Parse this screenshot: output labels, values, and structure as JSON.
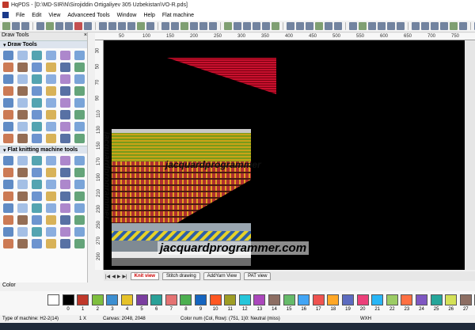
{
  "window": {
    "title": "HqPDS - [D:\\MD-SIR\\N\\Sirojiddin Ortigaliyev 305 Uzbekistan\\VO-R.pds]"
  },
  "menu": [
    "File",
    "Edit",
    "View",
    "Advanceed Tools",
    "Window",
    "Help",
    "Flat machine"
  ],
  "panel": {
    "title": "Draw Tools",
    "close_glyph": "×",
    "group_draw": "Draw Tools",
    "group_flat": "Flat knitting machine tools"
  },
  "ruler": {
    "top": [
      "50",
      "100",
      "150",
      "200",
      "250",
      "300",
      "350",
      "400",
      "450",
      "500",
      "550",
      "600",
      "650",
      "700",
      "750"
    ],
    "left": [
      "30",
      "50",
      "70",
      "90",
      "110",
      "130",
      "150",
      "170",
      "190",
      "210",
      "230",
      "250",
      "270",
      "290"
    ]
  },
  "canvas": {
    "watermark_main": "jacquardprogrammer.com",
    "watermark_inner": "jacquardprogrammer",
    "watermark_vertical": "jacquardprogrammer"
  },
  "tabs": {
    "nav": [
      "|◀",
      "◀",
      "▶",
      "▶|"
    ],
    "items": [
      {
        "label": "Knit view",
        "active": true
      },
      {
        "label": "Stitch drawing",
        "active": false
      },
      {
        "label": "AddYarn View",
        "active": false
      },
      {
        "label": "PAT view",
        "active": false
      }
    ]
  },
  "color": {
    "heading": "Color"
  },
  "palette": [
    {
      "label": "",
      "hex": "#ffffff"
    },
    {
      "label": "0",
      "hex": "#000000"
    },
    {
      "label": "1",
      "hex": "#c0392b"
    },
    {
      "label": "2",
      "hex": "#7fbf3f"
    },
    {
      "label": "3",
      "hex": "#3d8fd1"
    },
    {
      "label": "4",
      "hex": "#e6c229"
    },
    {
      "label": "5",
      "hex": "#7b3fa0"
    },
    {
      "label": "6",
      "hex": "#2aa198"
    },
    {
      "label": "7",
      "hex": "#e57373"
    },
    {
      "label": "8",
      "hex": "#4caf50"
    },
    {
      "label": "9",
      "hex": "#1565c0"
    },
    {
      "label": "10",
      "hex": "#ff5722"
    },
    {
      "label": "11",
      "hex": "#9e9d24"
    },
    {
      "label": "12",
      "hex": "#26c6da"
    },
    {
      "label": "13",
      "hex": "#ab47bc"
    },
    {
      "label": "14",
      "hex": "#8d6e63"
    },
    {
      "label": "15",
      "hex": "#66bb6a"
    },
    {
      "label": "16",
      "hex": "#42a5f5"
    },
    {
      "label": "17",
      "hex": "#ef5350"
    },
    {
      "label": "18",
      "hex": "#ffa726"
    },
    {
      "label": "19",
      "hex": "#5c6bc0"
    },
    {
      "label": "20",
      "hex": "#ec407a"
    },
    {
      "label": "21",
      "hex": "#29b6f6"
    },
    {
      "label": "22",
      "hex": "#9ccc65"
    },
    {
      "label": "23",
      "hex": "#ff7043"
    },
    {
      "label": "24",
      "hex": "#7e57c2"
    },
    {
      "label": "25",
      "hex": "#26a69a"
    },
    {
      "label": "26",
      "hex": "#d4e157"
    },
    {
      "label": "27",
      "hex": "#8d6e63"
    },
    {
      "label": "28",
      "hex": "#e53935"
    }
  ],
  "status": {
    "machine": "Type of machine: H2-2(14)",
    "zoom": "1 X",
    "canvas": "Canvas: 2048, 2048",
    "colornum": "Color num  (Col, Row): (751, 1)0: Neutral (miss)",
    "size": "WXH"
  },
  "colors": {
    "canvas": "#000000",
    "accent_red": "#c00000",
    "panel_head": "#dde4ee"
  }
}
